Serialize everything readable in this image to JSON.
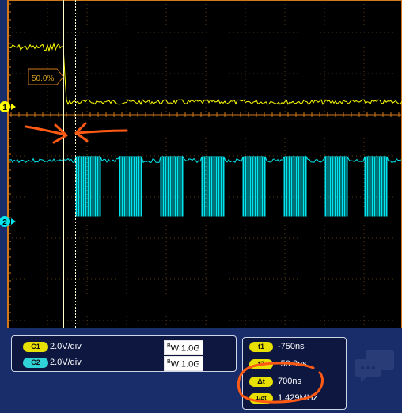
{
  "colors": {
    "background": "#1a2d6b",
    "plot_background": "#000000",
    "plot_border": "#d0781a",
    "grid": "#d0781a",
    "ch1": "#ffff00",
    "ch2": "#00e5ee",
    "annotation": "#ff5a14",
    "cursor": "#ffffcc"
  },
  "trigger": {
    "level_label": "50.0%"
  },
  "markers": {
    "ch1_label": "1",
    "ch2_label": "2"
  },
  "channels": [
    {
      "chip": "C1",
      "scale": "2.0V/div",
      "bw": "1.0G"
    },
    {
      "chip": "C2",
      "scale": "2.0V/div",
      "bw": "1.0G"
    }
  ],
  "cursor_readout": {
    "t1_label": "t1",
    "t1_value": "-750ns",
    "t2_label": "t2",
    "t2_value": "-50.0ns",
    "dt_label": "Δt",
    "dt_value": "700ns",
    "inv_label": "1/Δt",
    "inv_value": "1.429MHz"
  },
  "icons": {
    "chat_icon": "speech-bubble",
    "annotation_arrows": "arrow-right-and-arrow-left",
    "annotation_circle": "hand-drawn-circle"
  }
}
